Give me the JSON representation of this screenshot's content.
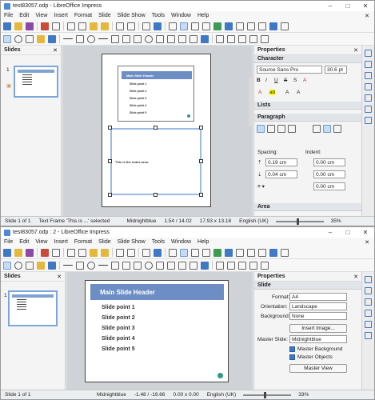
{
  "top": {
    "title": "test83057.odp - LibreOffice Impress",
    "menu": [
      "File",
      "Edit",
      "View",
      "Insert",
      "Format",
      "Slide",
      "Slide Show",
      "Tools",
      "Window",
      "Help"
    ],
    "slides_title": "Slides",
    "thumb_num": "1",
    "slide": {
      "header": "Main Slide Header",
      "points": [
        "Slide point 1",
        "Slide point 2",
        "Slide point 3",
        "Slide point 4",
        "Slide point 5"
      ],
      "notes": "This is the notes area."
    },
    "sidebar": {
      "title": "Properties",
      "character": "Character",
      "font": "Source Sans Pro",
      "size": "30.6 pt",
      "lists": "Lists",
      "paragraph": "Paragraph",
      "spacing": "Spacing:",
      "indent": "Indent:",
      "sp_above": "0.19 cm",
      "sp_below": "0.04 cm",
      "ind_before": "0.00 cm",
      "ind_after": "0.00 cm",
      "ind_first": "0.00 cm",
      "area": "Area"
    },
    "status": {
      "slide": "Slide 1 of 1",
      "sel": "Text Frame 'This is ...' selected",
      "master": "Midnightblue",
      "pos": "1.54 / 14.02",
      "size": "17.93 x 13.18",
      "lang": "English (UK)",
      "zoom": "35%"
    }
  },
  "bottom": {
    "title": "test83057.odp : 2 - LibreOffice Impress",
    "menu": [
      "File",
      "Edit",
      "View",
      "Insert",
      "Format",
      "Slide",
      "Slide Show",
      "Tools",
      "Window",
      "Help"
    ],
    "slides_title": "Slides",
    "thumb_num": "1",
    "slide": {
      "header": "Main Slide Header",
      "points": [
        "Slide point 1",
        "Slide point 2",
        "Slide point 3",
        "Slide point 4",
        "Slide point 5"
      ]
    },
    "sidebar": {
      "title": "Properties",
      "section": "Slide",
      "format_label": "Format:",
      "format_val": "A4",
      "orient_label": "Orientation:",
      "orient_val": "Landscape",
      "bg_label": "Background:",
      "bg_val": "None",
      "insert_image": "Insert Image...",
      "master_label": "Master Slide:",
      "master_val": "Midnightblue",
      "master_bg": "Master Background",
      "master_obj": "Master Objects",
      "master_view": "Master View"
    },
    "status": {
      "slide": "Slide 1 of 1",
      "master": "Midnightblue",
      "pos": "-1.48 / -19.66",
      "size": "0.00 x 0.00",
      "lang": "English (UK)",
      "zoom": "33%"
    }
  }
}
